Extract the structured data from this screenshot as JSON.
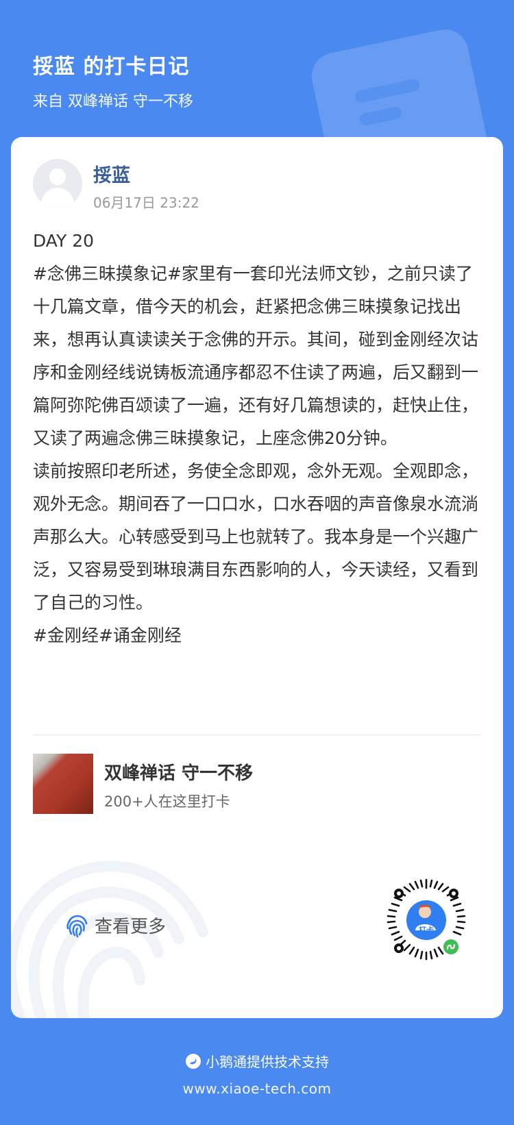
{
  "header": {
    "title": "挼蓝 的打卡日记",
    "subtitle": "来自 双峰禅话 守一不移"
  },
  "post": {
    "user_name": "挼蓝",
    "time": "06月17日 23:22",
    "lines": [
      "DAY 20",
      "#念佛三昧摸象记#家里有一套印光法师文钞，之前只读了十几篇文章，借今天的机会，赶紧把念佛三昧摸象记找出来，想再认真读读关于念佛的开示。其间，碰到金刚经次诂序和金刚经线说铸板流通序都忍不住读了两遍，后又翻到一篇阿弥陀佛百颂读了一遍，还有好几篇想读的，赶快止住，又读了两遍念佛三昧摸象记，上座念佛20分钟。",
      "读前按照印老所述，务使全念即观，念外无观。全观即念，观外无念。期间吞了一口口水，口水吞咽的声音像泉水流淌声那么大。心转感受到马上也就转了。我本身是一个兴趣广泛，又容易受到琳琅满目东西影响的人，今天读经，又看到了自己的习性。",
      "#金刚经#诵金刚经"
    ]
  },
  "course": {
    "title": "双峰禅话 守一不移",
    "count": "200+人在这里打卡"
  },
  "view_more": {
    "label": "查看更多"
  },
  "qr": {
    "badge": "打卡"
  },
  "footer": {
    "support": "小鹅通提供技术支持",
    "url": "www.xiaoe-tech.com"
  },
  "colors": {
    "background": "#4a8af0",
    "accent": "#2f7ff3",
    "user_name": "#3a5d9c"
  },
  "icons": [
    "fingerprint-icon",
    "mini-program-icon",
    "xiaoe-logo-icon"
  ]
}
